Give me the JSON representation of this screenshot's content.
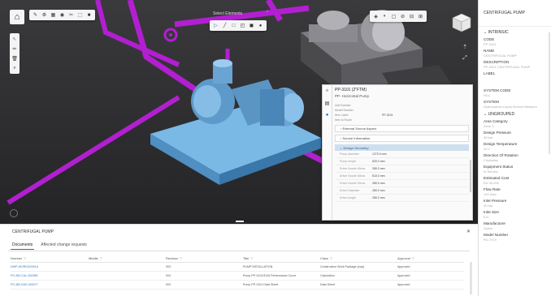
{
  "toolbar": {
    "home": "home",
    "tools": [
      "edit",
      "settings",
      "grid",
      "eye",
      "scissors",
      "capture",
      "monitor"
    ],
    "selectElements": "Select Elements",
    "selectTools": [
      "select",
      "line",
      "rectangle",
      "lasso",
      "rect-select",
      "circle-select"
    ],
    "rightTools": [
      "layers",
      "hide",
      "box",
      "measure",
      "clip",
      "grid"
    ]
  },
  "popup": {
    "title": "PP-3101 (2\"FTM)",
    "subtitle": "PP- Horizontal Pump",
    "fields": [
      {
        "k": "Unit Number",
        "v": ""
      },
      {
        "k": "Model Number",
        "v": ""
      },
      {
        "k": "Item Label",
        "v": "PP-3101"
      },
      {
        "k": "Item to Route",
        "v": ""
      }
    ],
    "sections": [
      "External Source Aspect",
      "Source Information"
    ],
    "open_section": "Design Geometry",
    "geometry": [
      {
        "k": "Pump diameter",
        "v": "1270.0 mm"
      },
      {
        "k": "Pump height",
        "v": "520.0 mm"
      },
      {
        "k": "Driver Nozzle Minus",
        "v": "280.0 mm"
      },
      {
        "k": "Driver Nozzle Minus",
        "v": "510.0 mm"
      },
      {
        "k": "Driver Nozzle Minus",
        "v": "280.0 mm"
      },
      {
        "k": "Driver Diameter",
        "v": "280.0 mm"
      },
      {
        "k": "Driver length",
        "v": "280.0 mm"
      }
    ]
  },
  "bottom": {
    "title": "CENTRIFUGAL PUMP",
    "tabs": [
      "Documents",
      "Affected change requests"
    ],
    "headers": [
      "Number",
      "Middle",
      "Revision",
      "Title",
      "Class",
      "Approval"
    ],
    "rows": [
      [
        "DWP-WORKDS001A",
        "",
        "003",
        "PUMP INSTALLATION",
        "Construction Work Package (cwp)",
        "Approved"
      ],
      [
        "PS-382-CAL-000385",
        "",
        "003",
        "Pump PP-3101/3115 Performance Curve",
        "Calculation",
        "Approved"
      ],
      [
        "PS-382-DAS-000077",
        "",
        "003",
        "Pump PP-3101 Data Sheet",
        "Data Sheet",
        "Approved"
      ]
    ]
  },
  "right": {
    "header": "CENTRIFUGAL PUMP",
    "group1": "INTRINSIC",
    "fields1": [
      {
        "lab": "CODE",
        "val": "PP-3101"
      },
      {
        "lab": "NAME",
        "val": "CENTRIFUGAL PUMP"
      },
      {
        "lab": "DESCRIPTION",
        "val": "PP-3101 CENTRIFUGAL PUMP"
      },
      {
        "lab": "LABEL",
        "val": ""
      },
      {
        "lab": "SYSTEM CODE",
        "val": "HCL"
      },
      {
        "lab": "SYSTEM",
        "val": "Hydrocarbon Liquid Service Between"
      }
    ],
    "group2": "UNGROUPED",
    "fields2": [
      {
        "lab": "Area Category",
        "val": "Zone 2"
      },
      {
        "lab": "Design Pressure",
        "val": "30 bar"
      },
      {
        "lab": "Design Temperature",
        "val": "20 C"
      },
      {
        "lab": "Direction Of Rotation",
        "val": "Clockwise"
      },
      {
        "lab": "Equipment Status",
        "val": "In Service"
      },
      {
        "lab": "Estimated Cost",
        "val": "EU 40,000"
      },
      {
        "lab": "Flow Rate",
        "val": "120 l/sec"
      },
      {
        "lab": "Inlet Pressure",
        "val": "30 bar"
      },
      {
        "lab": "Inlet Size",
        "val": "6 in"
      },
      {
        "lab": "Manufacturer",
        "val": "Sulzer"
      },
      {
        "lab": "Model Number",
        "val": "PU-7470"
      }
    ]
  }
}
